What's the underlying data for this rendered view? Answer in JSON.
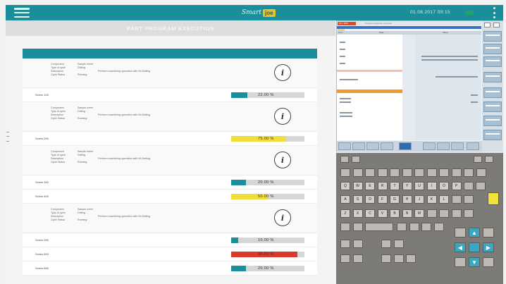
{
  "topbar": {
    "brand_text": "Smart",
    "brand_logo": "joe",
    "datetime": "01.08.2017  09:15",
    "menu_icon": "hamburger-icon",
    "more_icon": "kebab-icon",
    "accent_color": "#1a8e9a"
  },
  "left_panel": {
    "subheader_title": "PART PROGRAM EXECUTION",
    "detail_block": {
      "labels": [
        "Component",
        "Type of cycle",
        "Description",
        "Cycle Status"
      ],
      "values": [
        "Sample sheet",
        "Drilling",
        "",
        "Running"
      ],
      "description": "Perform machining operation with M-Setting",
      "info_glyph": "i"
    },
    "rows": [
      {
        "name": "Screw 100",
        "value": "22.00 %",
        "level": 0.22,
        "color": "#1a8e9a"
      },
      {
        "name": "Screw 200",
        "value": "75.00 %",
        "level": 0.75,
        "color": "#f1dd3a"
      },
      {
        "name": "Screw 300",
        "value": "20.00 %",
        "level": 0.2,
        "color": "#1a8e9a"
      },
      {
        "name": "Screw 400",
        "value": "50.00 %",
        "level": 0.5,
        "color": "#f1dd3a"
      },
      {
        "name": "Screw 500",
        "value": "10.00 %",
        "level": 0.1,
        "color": "#1a8e9a"
      },
      {
        "name": "Screw 600",
        "value": "90.00 %",
        "level": 0.9,
        "color": "#d93a2a"
      },
      {
        "name": "Screw 800",
        "value": "20.00 %",
        "level": 0.2,
        "color": "#1a8e9a"
      }
    ]
  },
  "hmi": {
    "red_label": "NC / MPF",
    "title": "Program execution overview",
    "headers": [
      "Tool",
      "Data",
      "Value"
    ],
    "colors": {
      "blue_bar": "#3b6fc0",
      "orange_row": "#ef9a2a",
      "red_tag": "#e34c27"
    }
  },
  "keyboard": {
    "row_top": [
      "Q",
      "W",
      "E",
      "R",
      "T",
      "Y",
      "U",
      "I",
      "O",
      "P"
    ],
    "row_mid": [
      "A",
      "S",
      "D",
      "F",
      "G",
      "H",
      "J",
      "K",
      "L"
    ],
    "row_bot": [
      "Z",
      "X",
      "C",
      "V",
      "B",
      "N",
      "M"
    ],
    "arrow_up": "▲",
    "arrow_down": "▼",
    "arrow_left": "◀",
    "arrow_right": "▶",
    "highlight_color": "#f2e23c"
  }
}
